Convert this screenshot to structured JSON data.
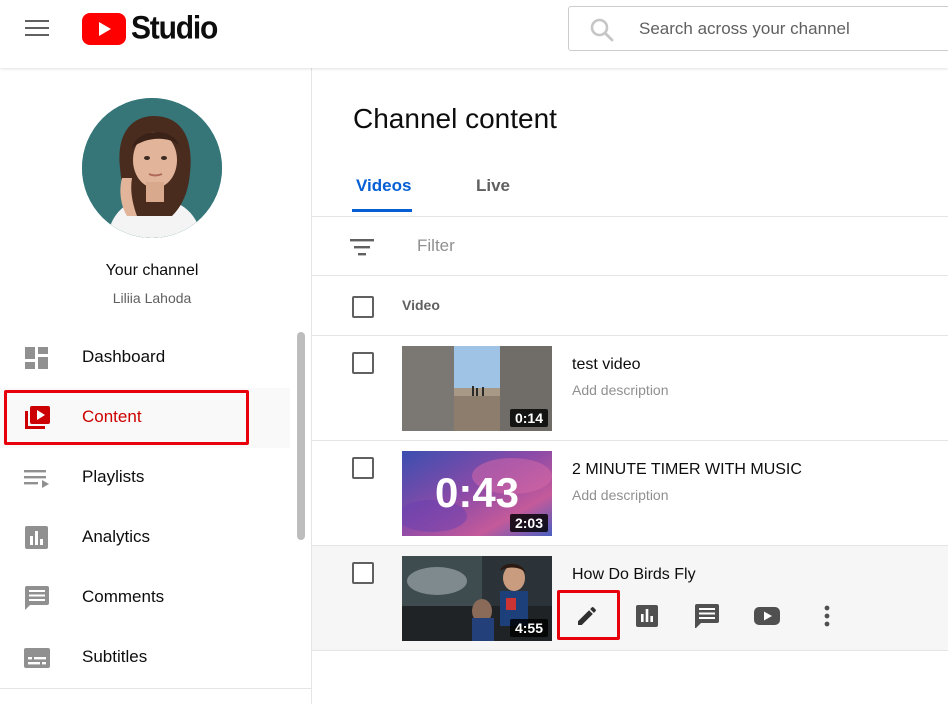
{
  "header": {
    "logo_text": "Studio",
    "search_placeholder": "Search across your channel"
  },
  "sidebar": {
    "channel_title": "Your channel",
    "channel_name": "Liliia Lahoda",
    "items": [
      {
        "label": "Dashboard",
        "icon": "dashboard-icon",
        "active": false
      },
      {
        "label": "Content",
        "icon": "content-icon",
        "active": true
      },
      {
        "label": "Playlists",
        "icon": "playlists-icon",
        "active": false
      },
      {
        "label": "Analytics",
        "icon": "analytics-icon",
        "active": false
      },
      {
        "label": "Comments",
        "icon": "comments-icon",
        "active": false
      },
      {
        "label": "Subtitles",
        "icon": "subtitles-icon",
        "active": false
      }
    ]
  },
  "main": {
    "title": "Channel content",
    "tabs": [
      {
        "label": "Videos",
        "active": true
      },
      {
        "label": "Live",
        "active": false
      }
    ],
    "filter_placeholder": "Filter",
    "column_video": "Video",
    "videos": [
      {
        "title": "test video",
        "description": "Add description",
        "duration": "0:14"
      },
      {
        "title": "2 MINUTE TIMER WITH MUSIC",
        "description": "Add description",
        "duration": "2:03",
        "thumb_text": "0:43"
      },
      {
        "title": "How Do Birds Fly",
        "description": "",
        "duration": "4:55"
      }
    ],
    "row_actions": [
      "edit-icon",
      "analytics-icon",
      "comments-icon",
      "youtube-icon",
      "more-options-icon"
    ]
  },
  "colors": {
    "accent_blue": "#065fd4",
    "active_red": "#cc0000",
    "highlight_outline": "#e8000b",
    "youtube_red": "#ff0000"
  }
}
